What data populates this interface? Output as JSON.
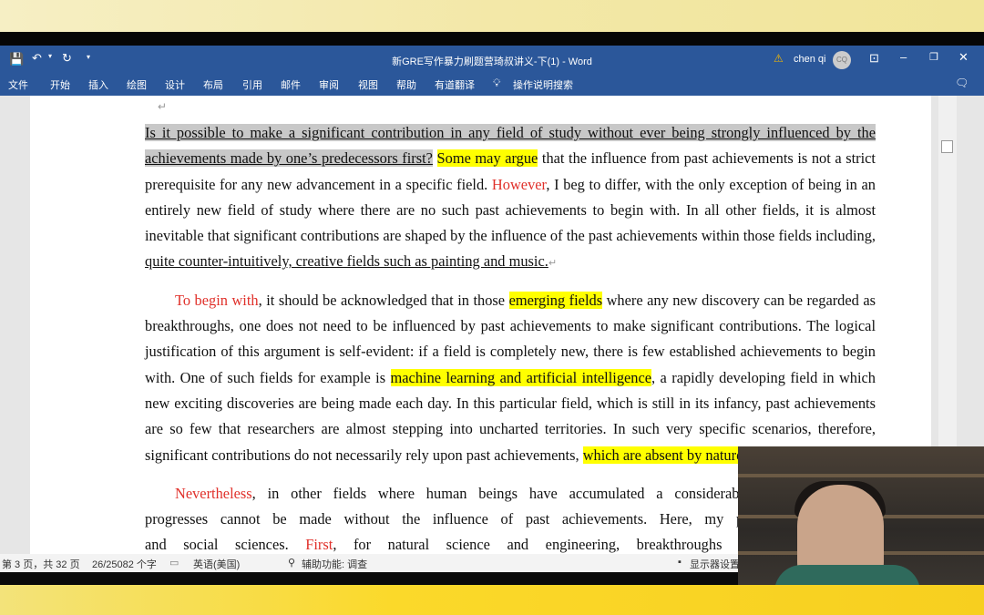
{
  "window": {
    "title": "新GRE写作暴力刷题营琦叔讲义-下(1) - Word",
    "user": "chen qi",
    "avatar_initials": "CQ",
    "accent": "#2b579a"
  },
  "quick_access": {
    "save_icon": "save-icon",
    "undo_icon": "undo-icon",
    "redo_icon": "redo-icon",
    "customize_icon": "chevron-down-icon"
  },
  "menu": {
    "items": [
      "文件",
      "开始",
      "插入",
      "绘图",
      "设计",
      "布局",
      "引用",
      "邮件",
      "审阅",
      "视图",
      "帮助",
      "有道翻译"
    ],
    "search": "操作说明搜索"
  },
  "document": {
    "paragraphs": [
      {
        "indent": false,
        "lines": [
          [
            {
              "s": "ug",
              "t": "Is it possible to make a significant contribution in any field of study without ever being strongly influenced by the"
            }
          ],
          [
            {
              "s": "ug",
              "t": "achievements made by one’s predecessors first?"
            },
            {
              "s": "",
              "t": " "
            },
            {
              "s": "hl",
              "t": "Some may argue"
            },
            {
              "s": "",
              "t": " that the influence from past achievements is not a strict"
            }
          ],
          [
            {
              "s": "",
              "t": "prerequisite for any new advancement in a specific field. "
            },
            {
              "s": "red",
              "t": "However"
            },
            {
              "s": "",
              "t": ", I beg to differ, with the only exception of being in an"
            }
          ],
          [
            {
              "s": "",
              "t": "entirely new field of study where there are no such past achievements to begin with. In all other fields, it is almost"
            }
          ],
          [
            {
              "s": "",
              "t": "inevitable that significant contributions are shaped by the influence of the past achievements within those fields including,"
            }
          ],
          [
            {
              "s": "u",
              "t": "quite counter-intuitively, creative fields such as painting and music."
            },
            {
              "s": "mark",
              "t": "↵"
            }
          ]
        ]
      },
      {
        "indent": true,
        "lines": [
          [
            {
              "s": "red",
              "t": "To begin with"
            },
            {
              "s": "",
              "t": ", it should be acknowledged that in those "
            },
            {
              "s": "hl",
              "t": "emerging fields"
            },
            {
              "s": "",
              "t": " where any new discovery can be regarded as"
            }
          ],
          [
            {
              "s": "",
              "t": "breakthroughs, one does not need to be influenced by past achievements to make significant contributions. The logical"
            }
          ],
          [
            {
              "s": "",
              "t": "justification of this argument is self-evident: if a field is completely new, there is few established achievements to begin"
            }
          ],
          [
            {
              "s": "",
              "t": "with. One of such fields for example is "
            },
            {
              "s": "hl",
              "t": "machine learning and artificial intelligence"
            },
            {
              "s": "",
              "t": ", a rapidly developing field in which"
            }
          ],
          [
            {
              "s": "",
              "t": "new exciting discoveries are being made each day. In this particular field, which is still in its infancy, past achievements"
            }
          ],
          [
            {
              "s": "",
              "t": "are so few that researchers are almost stepping into uncharted territories. In such very specific scenarios, therefore,"
            }
          ],
          [
            {
              "s": "",
              "t": "significant contributions do not necessarily rely upon past achievements, "
            },
            {
              "s": "hl",
              "t": "which are absent by nature"
            },
            {
              "s": "",
              "t": "."
            },
            {
              "s": "mark",
              "t": "↵"
            }
          ]
        ]
      },
      {
        "indent": true,
        "lines": [
          [
            {
              "s": "red",
              "t": "Nevertheless"
            },
            {
              "s": "",
              "t": ", in other fields where human beings have accumulated a considerable amount of know"
            }
          ],
          [
            {
              "s": "",
              "t": "progresses cannot be made without the influence of past achievements. Here, my point of view appli"
            }
          ],
          [
            {
              "s": "",
              "t": "and social sciences. "
            },
            {
              "s": "red",
              "t": "First"
            },
            {
              "s": "",
              "t": ", for natural science and engineering, breakthroughs and innovations ar"
            }
          ]
        ]
      }
    ],
    "return_mark": "↵"
  },
  "status": {
    "page": "第 3 页，共 32 页",
    "words": "26/25082 个字",
    "language": "英语(美国)",
    "accessibility": "辅助功能: 调查",
    "display": "显示器设置"
  }
}
